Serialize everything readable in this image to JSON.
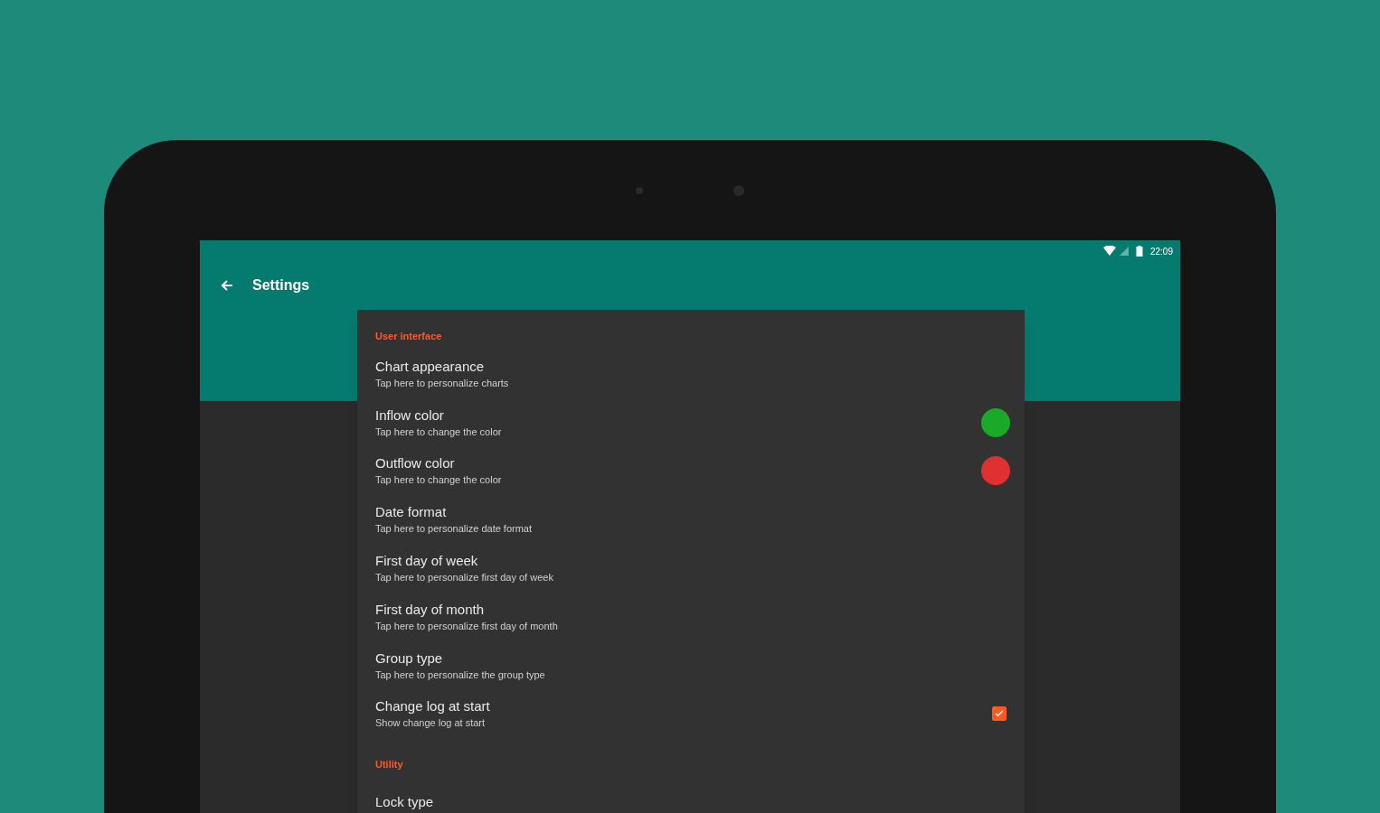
{
  "status_bar": {
    "time": "22:09"
  },
  "app_bar": {
    "title": "Settings"
  },
  "settings": [
    {
      "kind": "header",
      "title": "User interface"
    },
    {
      "kind": "plain",
      "title": "Chart appearance",
      "summary": "Tap here to personalize charts"
    },
    {
      "kind": "color",
      "title": "Inflow color",
      "summary": "Tap here to change the color",
      "color": "#1aaa2a"
    },
    {
      "kind": "color",
      "title": "Outflow color",
      "summary": "Tap here to change the color",
      "color": "#e03030"
    },
    {
      "kind": "plain",
      "title": "Date format",
      "summary": "Tap here to personalize date format"
    },
    {
      "kind": "plain",
      "title": "First day of week",
      "summary": "Tap here to personalize first day of week"
    },
    {
      "kind": "plain",
      "title": "First day of month",
      "summary": "Tap here to personalize first day of month"
    },
    {
      "kind": "plain",
      "title": "Group type",
      "summary": "Tap here to personalize the group type"
    },
    {
      "kind": "check",
      "title": "Change log at start",
      "summary": "Show change log at start",
      "checked": true
    },
    {
      "kind": "header",
      "title": "Utility"
    },
    {
      "kind": "plain",
      "title": "Lock type"
    }
  ]
}
